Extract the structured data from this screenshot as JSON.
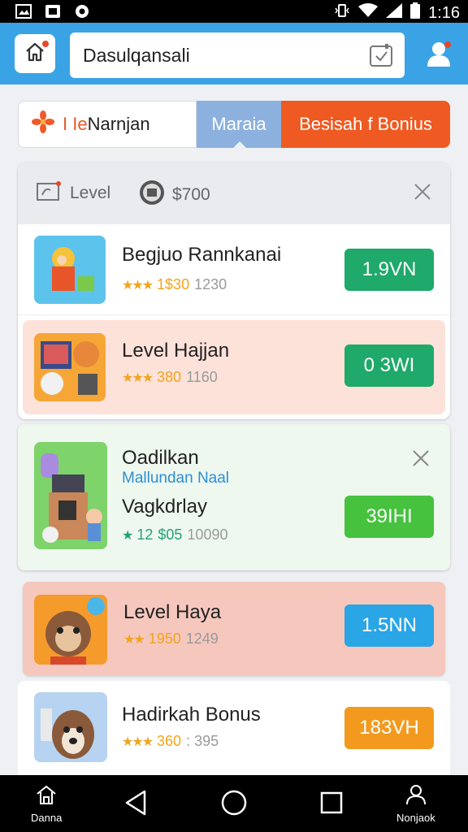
{
  "status_bar": {
    "time": "1:16",
    "icons": [
      "gallery-icon",
      "photo-icon",
      "settings-icon",
      "vibrate-icon",
      "wifi-icon",
      "signal-icon",
      "battery-icon"
    ]
  },
  "header": {
    "search": {
      "value": "Dasulqansali"
    },
    "icons": [
      "home-icon",
      "calendar-check-icon",
      "profile-icon"
    ]
  },
  "tabs": {
    "tab1_prefix": "I Ie",
    "tab1_label": "Narnjan",
    "tab2_label": "Maraia",
    "tab3_label": "Besisah f Bonius"
  },
  "panel": {
    "level_label": "Level",
    "coin_value": "$700"
  },
  "items": [
    {
      "title": "Begjuo Rannkanai",
      "stars": "★★★",
      "price": "1$30",
      "count": "1230",
      "button": "1.9VN",
      "button_color": "#1fa96a"
    },
    {
      "title": "Level Hajjan",
      "stars": "★★★",
      "price": "380",
      "count": "1160",
      "button": "0 3WI",
      "button_color": "#1fa96a"
    }
  ],
  "featured": {
    "title": "Oadilkan",
    "subtitle": "Mallundan Naal",
    "title2": "Vagkdrlay",
    "stars": "★",
    "rating": "12",
    "price": "$05",
    "count": "10090",
    "button": "39IHI",
    "button_color": "#46c23e"
  },
  "items_bottom": [
    {
      "title": "Level Haya",
      "stars": "★★",
      "price": "1950",
      "count": "1249",
      "button": "1.5NN",
      "button_color": "#2aa5e6"
    },
    {
      "title": "Hadirkah Bonus",
      "stars": "★★★",
      "price": "360",
      "count": ": 395",
      "button": "183VH",
      "button_color": "#f39a1e"
    }
  ],
  "nav": {
    "left_label": "Danna",
    "right_label": "Nonjaok",
    "icons": [
      "home-nav-icon",
      "back-icon",
      "home-circle-icon",
      "recent-apps-icon",
      "user-nav-icon"
    ]
  }
}
